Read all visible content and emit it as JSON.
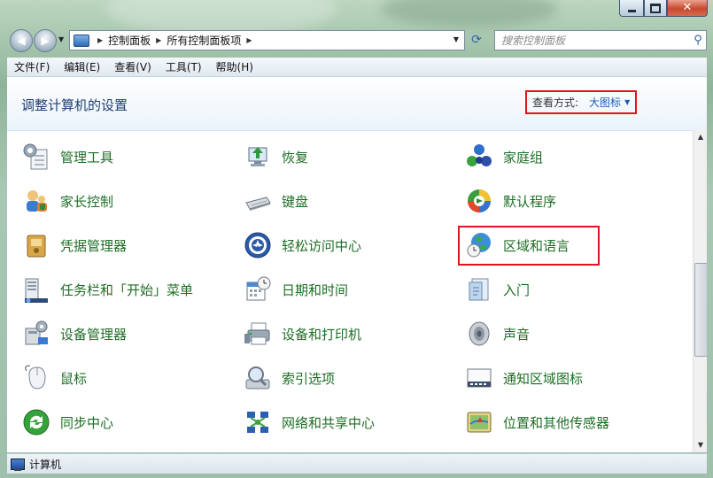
{
  "address": {
    "crumbs": [
      "控制面板",
      "所有控制面板项"
    ]
  },
  "search": {
    "placeholder": "搜索控制面板"
  },
  "menu": [
    "文件(F)",
    "编辑(E)",
    "查看(V)",
    "工具(T)",
    "帮助(H)"
  ],
  "header": {
    "title": "调整计算机的设置",
    "view_label": "查看方式:",
    "view_value": "大图标"
  },
  "items": [
    {
      "label": "管理工具",
      "icon": "admin-tools-icon"
    },
    {
      "label": "恢复",
      "icon": "recovery-icon"
    },
    {
      "label": "家庭组",
      "icon": "homegroup-icon"
    },
    {
      "label": "家长控制",
      "icon": "parental-controls-icon"
    },
    {
      "label": "键盘",
      "icon": "keyboard-icon"
    },
    {
      "label": "默认程序",
      "icon": "default-programs-icon"
    },
    {
      "label": "凭据管理器",
      "icon": "credential-manager-icon"
    },
    {
      "label": "轻松访问中心",
      "icon": "ease-of-access-icon"
    },
    {
      "label": "区域和语言",
      "icon": "region-language-icon",
      "highlighted": true
    },
    {
      "label": "任务栏和「开始」菜单",
      "icon": "taskbar-start-icon"
    },
    {
      "label": "日期和时间",
      "icon": "date-time-icon"
    },
    {
      "label": "入门",
      "icon": "getting-started-icon"
    },
    {
      "label": "设备管理器",
      "icon": "device-manager-icon"
    },
    {
      "label": "设备和打印机",
      "icon": "devices-printers-icon"
    },
    {
      "label": "声音",
      "icon": "sound-icon"
    },
    {
      "label": "鼠标",
      "icon": "mouse-icon"
    },
    {
      "label": "索引选项",
      "icon": "indexing-options-icon"
    },
    {
      "label": "通知区域图标",
      "icon": "notification-area-icon"
    },
    {
      "label": "同步中心",
      "icon": "sync-center-icon"
    },
    {
      "label": "网络和共享中心",
      "icon": "network-sharing-icon"
    },
    {
      "label": "位置和其他传感器",
      "icon": "location-sensors-icon"
    }
  ],
  "status": {
    "text": "计算机"
  },
  "colors": {
    "link_green": "#1e6e25",
    "highlight_red": "#e0151c",
    "title_blue": "#1f3f6e"
  }
}
